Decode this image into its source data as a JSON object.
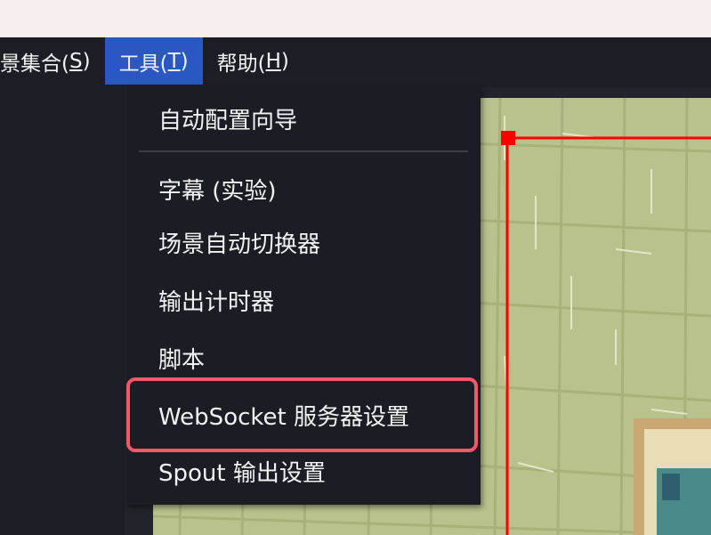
{
  "window": {
    "titlebar_color": "#f7eef0"
  },
  "menubar": {
    "items": [
      {
        "label": "景集合(",
        "mnemonic": "S",
        "suffix": ")"
      },
      {
        "label": "工具(",
        "mnemonic": "T",
        "suffix": ")"
      },
      {
        "label": "帮助(",
        "mnemonic": "H",
        "suffix": ")"
      }
    ],
    "active_color": "#2b57c2"
  },
  "tools_menu": {
    "items": [
      "自动配置向导",
      "字幕 (实验)",
      "场景自动切换器",
      "输出计时器",
      "脚本",
      "WebSocket 服务器设置",
      "Spout 输出设置"
    ],
    "highlighted_item": "WebSocket 服务器设置",
    "highlight_color": "#f2576a"
  },
  "preview": {
    "selection_color": "#ff0000"
  }
}
